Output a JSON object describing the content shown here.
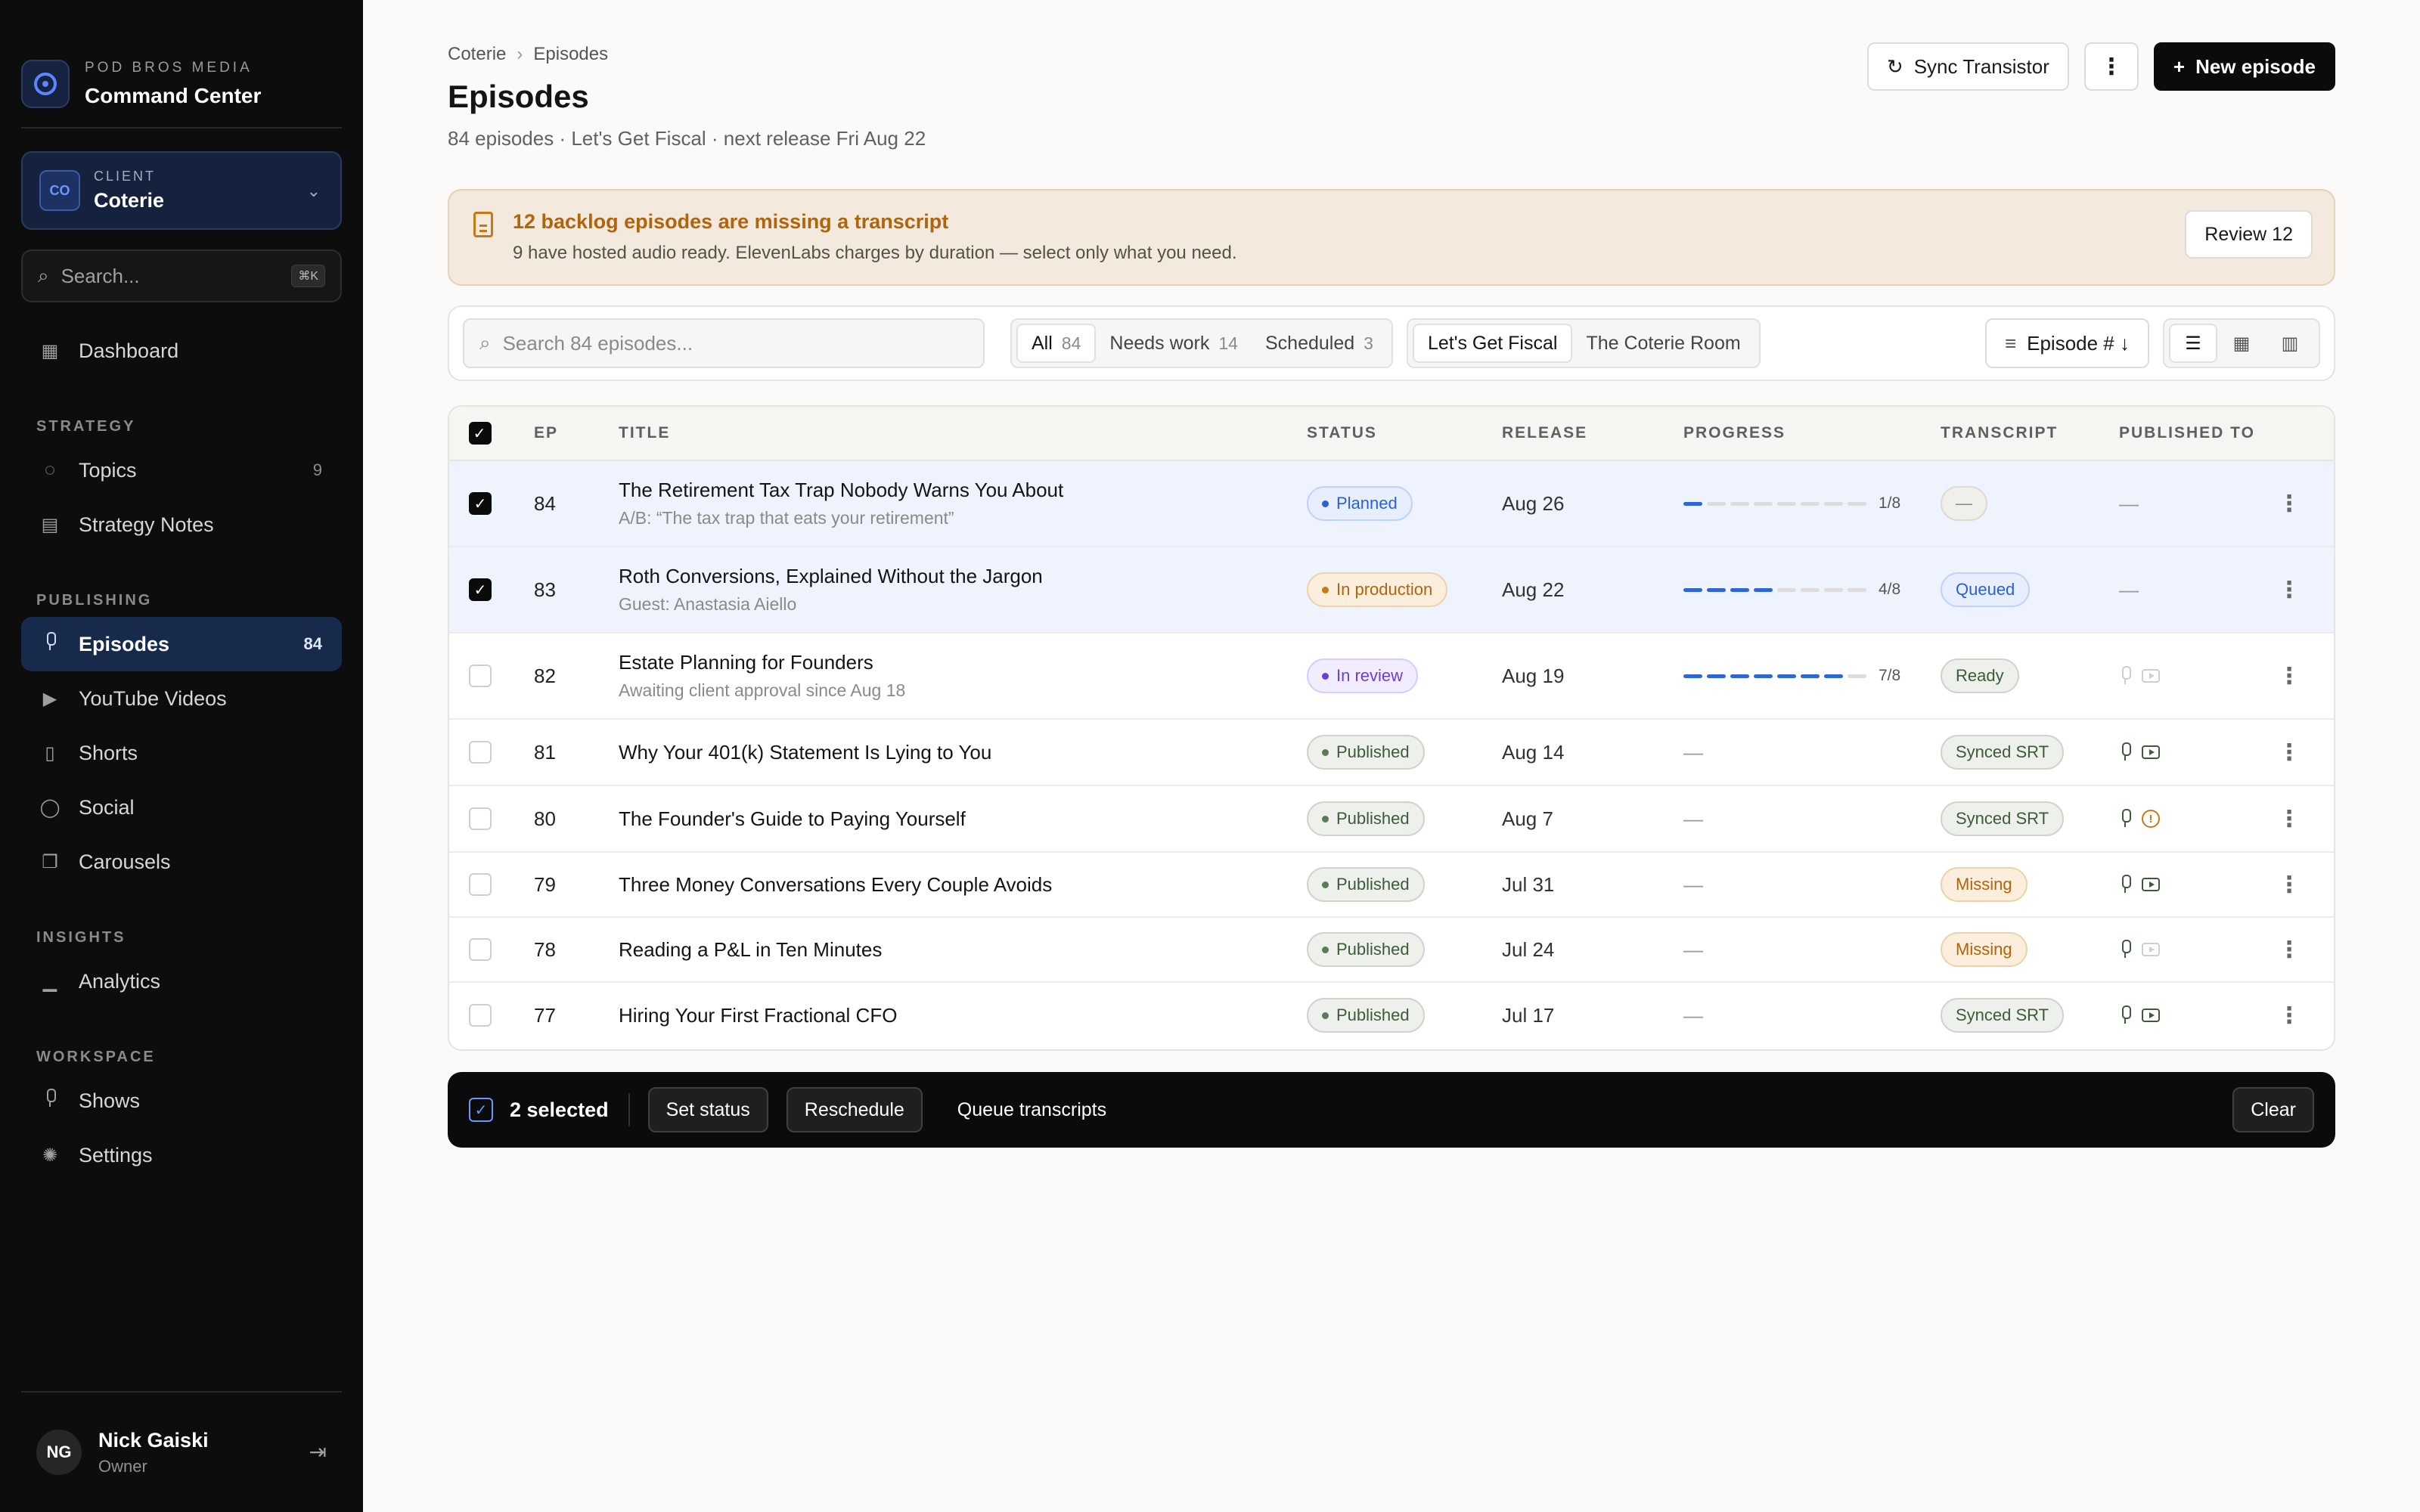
{
  "brand": {
    "org": "POD BROS MEDIA",
    "app": "Command Center"
  },
  "client": {
    "caption": "CLIENT",
    "initials": "CO",
    "name": "Coterie"
  },
  "sidebar_search": {
    "placeholder": "Search...",
    "shortcut": "⌘K"
  },
  "nav": {
    "dashboard": "Dashboard",
    "groups": [
      {
        "caption": "STRATEGY",
        "items": [
          {
            "label": "Topics",
            "count": "9",
            "icon": "lightbulb-icon"
          },
          {
            "label": "Strategy Notes",
            "count": "",
            "icon": "note-icon"
          }
        ]
      },
      {
        "caption": "PUBLISHING",
        "items": [
          {
            "label": "Episodes",
            "count": "84",
            "icon": "mic-icon",
            "active": true
          },
          {
            "label": "YouTube Videos",
            "count": "",
            "icon": "video-icon"
          },
          {
            "label": "Shorts",
            "count": "",
            "icon": "phone-icon"
          },
          {
            "label": "Social",
            "count": "",
            "icon": "chat-icon"
          },
          {
            "label": "Carousels",
            "count": "",
            "icon": "layers-icon"
          }
        ]
      },
      {
        "caption": "INSIGHTS",
        "items": [
          {
            "label": "Analytics",
            "count": "",
            "icon": "chart-icon"
          }
        ]
      },
      {
        "caption": "WORKSPACE",
        "items": [
          {
            "label": "Shows",
            "count": "",
            "icon": "mic-icon"
          },
          {
            "label": "Settings",
            "count": "",
            "icon": "gear-icon"
          }
        ]
      }
    ]
  },
  "user": {
    "initials": "NG",
    "name": "Nick Gaiski",
    "role": "Owner"
  },
  "header": {
    "breadcrumb": [
      "Coterie",
      "Episodes"
    ],
    "title": "Episodes",
    "subtitle": "84 episodes · Let's Get Fiscal · next release Fri Aug 22",
    "sync_label": "Sync Transistor",
    "more_label": "⋮",
    "new_label": "New episode"
  },
  "alert": {
    "title": "12 backlog episodes are missing a transcript",
    "text": "9 have hosted audio ready. ElevenLabs charges by duration — select only what you need.",
    "action": "Review 12"
  },
  "toolbar": {
    "search_placeholder": "Search 84 episodes...",
    "filters": [
      {
        "label": "All",
        "count": "84",
        "active": true
      },
      {
        "label": "Needs work",
        "count": "14"
      },
      {
        "label": "Scheduled",
        "count": "3"
      }
    ],
    "shows": [
      {
        "label": "Let's Get Fiscal",
        "active": true
      },
      {
        "label": "The Coterie Room"
      }
    ],
    "sort_label": "Episode # ↓"
  },
  "table": {
    "columns": [
      "EP",
      "TITLE",
      "STATUS",
      "RELEASE",
      "PROGRESS",
      "TRANSCRIPT",
      "PUBLISHED TO"
    ],
    "rows": [
      {
        "ep": "84",
        "title": "The Retirement Tax Trap Nobody Warns You About",
        "sub": "A/B: “The tax trap that eats your retirement”",
        "status": "Planned",
        "status_kind": "planned",
        "release": "Aug 26",
        "progress": 1,
        "progress_total": 8,
        "progress_label": "1/8",
        "transcript": "—",
        "transcript_kind": "none",
        "published": "—",
        "selected": true
      },
      {
        "ep": "83",
        "title": "Roth Conversions, Explained Without the Jargon",
        "sub": "Guest: Anastasia Aiello",
        "status": "In production",
        "status_kind": "prod",
        "release": "Aug 22",
        "progress": 4,
        "progress_total": 8,
        "progress_label": "4/8",
        "transcript": "Queued",
        "transcript_kind": "queued",
        "published": "—",
        "selected": true
      },
      {
        "ep": "82",
        "title": "Estate Planning for Founders",
        "sub": "Awaiting client approval since Aug 18",
        "status": "In review",
        "status_kind": "review",
        "release": "Aug 19",
        "progress": 7,
        "progress_total": 8,
        "progress_label": "7/8",
        "transcript": "Ready",
        "transcript_kind": "ready",
        "pub_icons": [
          "faded",
          "faded"
        ],
        "selected": false
      },
      {
        "ep": "81",
        "title": "Why Your 401(k) Statement Is Lying to You",
        "sub": "",
        "status": "Published",
        "status_kind": "pub",
        "release": "Aug 14",
        "progress_dash": "—",
        "transcript": "Synced SRT",
        "transcript_kind": "synced",
        "pub_icons": [
          "ok",
          "ok"
        ],
        "selected": false
      },
      {
        "ep": "80",
        "title": "The Founder's Guide to Paying Yourself",
        "sub": "",
        "status": "Published",
        "status_kind": "pub",
        "release": "Aug 7",
        "progress_dash": "—",
        "transcript": "Synced SRT",
        "transcript_kind": "synced",
        "pub_icons": [
          "ok",
          "warn"
        ],
        "selected": false
      },
      {
        "ep": "79",
        "title": "Three Money Conversations Every Couple Avoids",
        "sub": "",
        "status": "Published",
        "status_kind": "pub",
        "release": "Jul 31",
        "progress_dash": "—",
        "transcript": "Missing",
        "transcript_kind": "missing",
        "pub_icons": [
          "ok",
          "ok"
        ],
        "selected": false
      },
      {
        "ep": "78",
        "title": "Reading a P&L in Ten Minutes",
        "sub": "",
        "status": "Published",
        "status_kind": "pub",
        "release": "Jul 24",
        "progress_dash": "—",
        "transcript": "Missing",
        "transcript_kind": "missing",
        "pub_icons": [
          "ok",
          "faded"
        ],
        "selected": false
      },
      {
        "ep": "77",
        "title": "Hiring Your First Fractional CFO",
        "sub": "",
        "status": "Published",
        "status_kind": "pub",
        "release": "Jul 17",
        "progress_dash": "—",
        "transcript": "Synced SRT",
        "transcript_kind": "synced",
        "pub_icons": [
          "ok",
          "ok"
        ],
        "selected": false
      }
    ]
  },
  "bulk": {
    "selected_label": "2 selected",
    "set_status": "Set status",
    "reschedule": "Reschedule",
    "queue": "Queue transcripts",
    "clear": "Clear"
  },
  "colors": {
    "accent": "#2f66d6",
    "sidebar_bg": "#0d0d0d",
    "warning": "#b0640c"
  }
}
